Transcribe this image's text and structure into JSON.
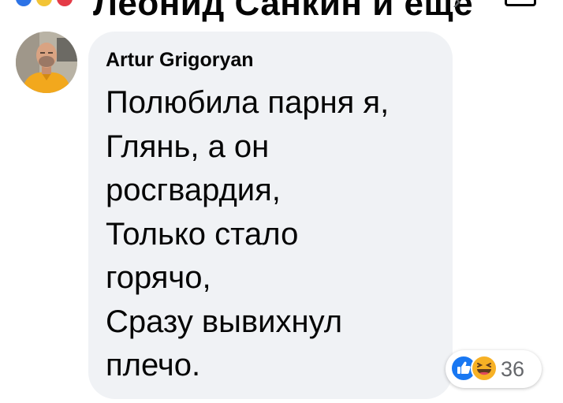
{
  "header": {
    "title": "Леонид Санкин и еще",
    "chevron": "›"
  },
  "comment": {
    "author": "Artur Grigoryan",
    "lines": [
      "Полюбила парня я,",
      "Глянь, а он",
      "росгвардия,",
      "Только стало",
      "горячо,",
      "Сразу вывихнул",
      "плечо."
    ],
    "reactions": {
      "icons": [
        "like-icon",
        "haha-icon"
      ],
      "count": "36"
    }
  },
  "colors": {
    "bubble": "#f0f2f5",
    "like_blue": "#1877f2",
    "haha_yellow": "#f7b125",
    "text": "#050505",
    "meta": "#65676b"
  }
}
